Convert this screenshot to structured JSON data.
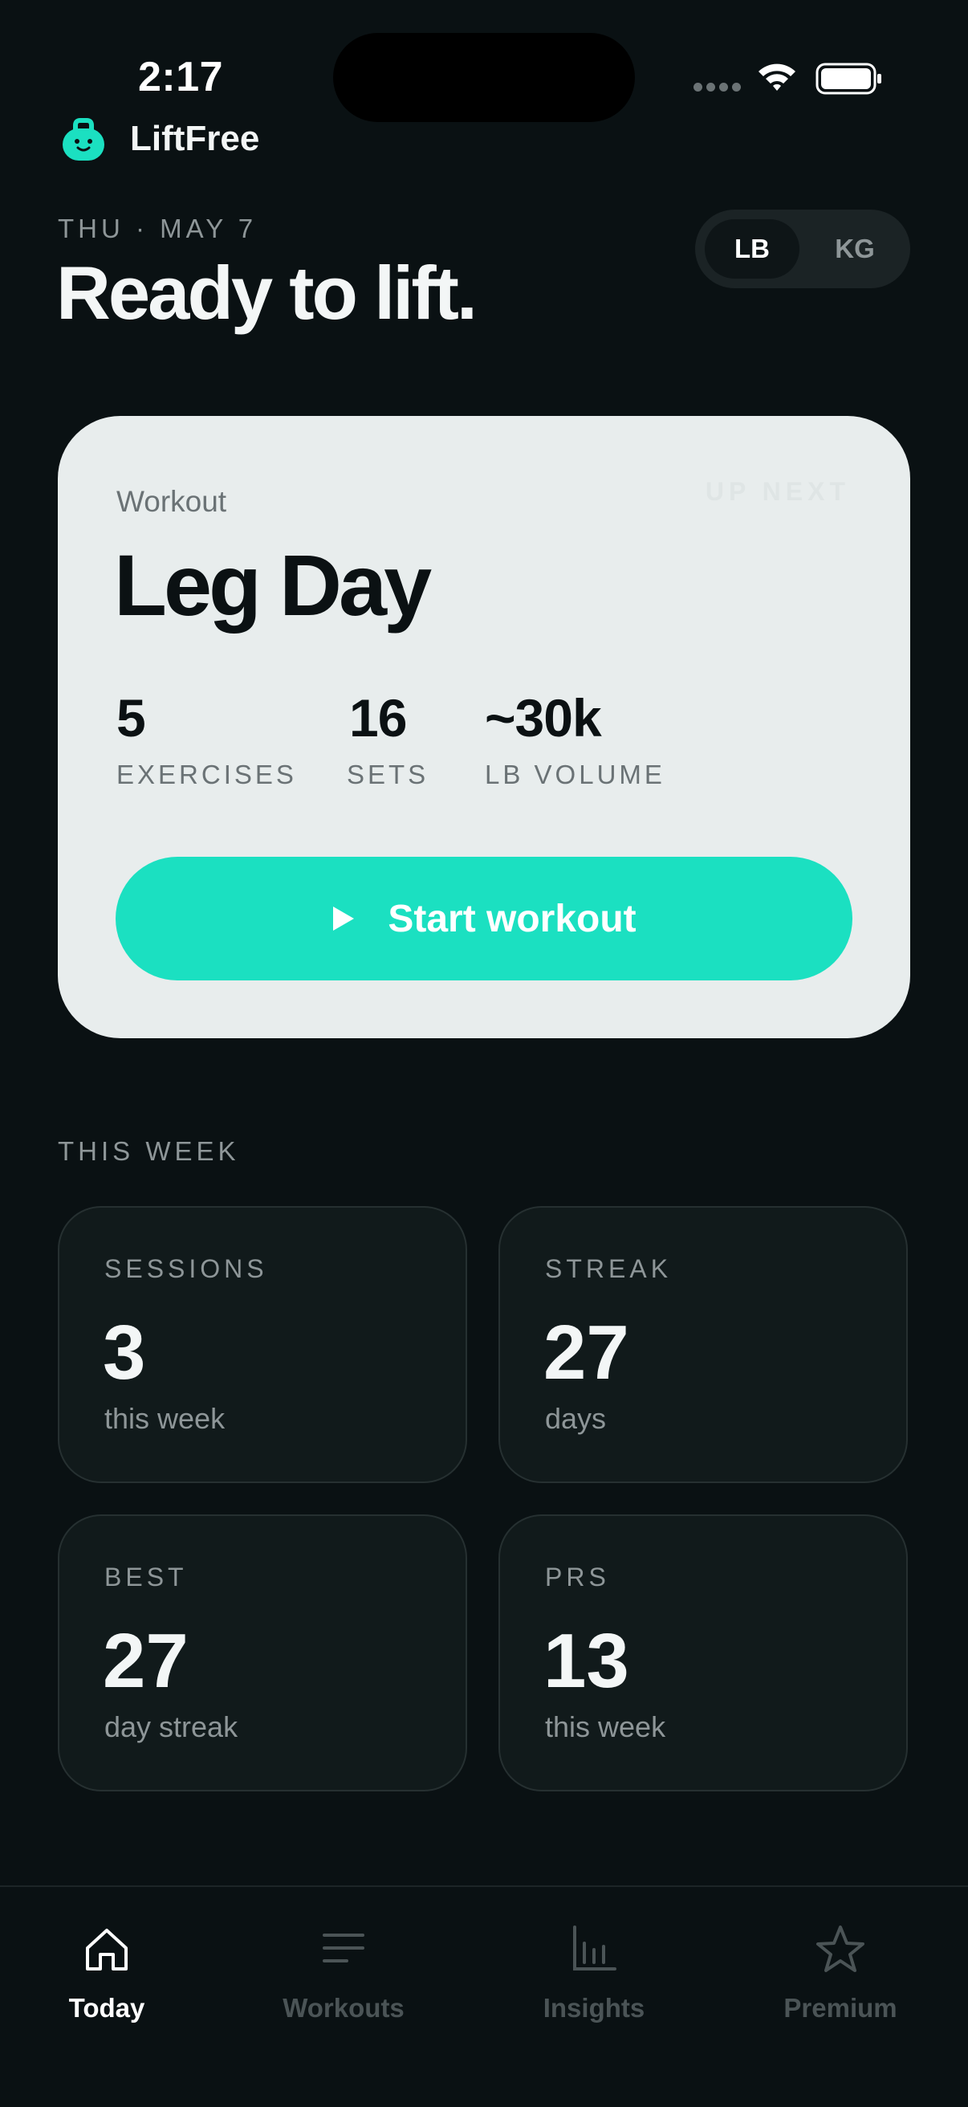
{
  "status_bar": {
    "time": "2:17"
  },
  "app": {
    "name": "LiftFree",
    "logo_icon": "kettlebell-smile-icon"
  },
  "header": {
    "date": "THU · MAY 7",
    "greeting": "Ready to lift.",
    "unit_toggle": {
      "options": [
        "LB",
        "KG"
      ],
      "selected": "LB"
    }
  },
  "workout_card": {
    "label": "Workout",
    "badge": "UP NEXT",
    "title": "Leg Day",
    "stats": [
      {
        "value": "5",
        "label": "EXERCISES"
      },
      {
        "value": "16",
        "label": "SETS"
      },
      {
        "value": "~30k",
        "label": "LB VOLUME"
      }
    ],
    "start_button": "Start workout"
  },
  "this_week": {
    "title": "THIS WEEK",
    "tiles": [
      {
        "label": "SESSIONS",
        "value": "3",
        "sub": "this week"
      },
      {
        "label": "STREAK",
        "value": "27",
        "sub": "days"
      },
      {
        "label": "BEST",
        "value": "27",
        "sub": "day streak"
      },
      {
        "label": "PRS",
        "value": "13",
        "sub": "this week"
      }
    ]
  },
  "tabbar": {
    "tabs": [
      {
        "label": "Today",
        "icon": "home-icon",
        "active": true
      },
      {
        "label": "Workouts",
        "icon": "list-icon",
        "active": false
      },
      {
        "label": "Insights",
        "icon": "bar-chart-icon",
        "active": false
      },
      {
        "label": "Premium",
        "icon": "star-icon",
        "active": false
      }
    ]
  },
  "colors": {
    "background": "#0a1113",
    "accent": "#1be0c1",
    "card": "#e8eded"
  }
}
